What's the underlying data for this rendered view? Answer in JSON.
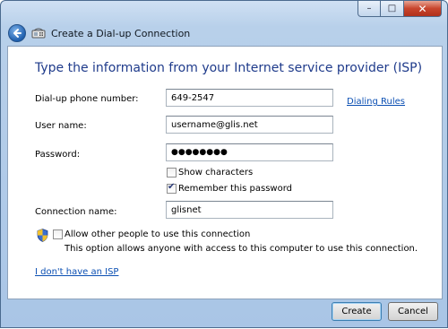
{
  "window": {
    "controls": {
      "minimize": "–",
      "maximize": "□",
      "close": "✕"
    }
  },
  "nav": {
    "title": "Create a Dial-up Connection",
    "back_icon": "back-arrow-icon",
    "app_icon": "dialup-modem-icon"
  },
  "form": {
    "heading": "Type the information from your Internet service provider (ISP)",
    "phone": {
      "label": "Dial-up phone number:",
      "value": "649-2547"
    },
    "dialing_rules_link": "Dialing Rules",
    "username": {
      "label": "User name:",
      "value": "username@glis.net"
    },
    "password": {
      "label": "Password:",
      "value": "●●●●●●●●"
    },
    "show_characters": {
      "label": "Show characters",
      "checked": false
    },
    "remember_password": {
      "label": "Remember this password",
      "checked": true
    },
    "connection_name": {
      "label": "Connection name:",
      "value": "glisnet"
    },
    "allow_others": {
      "label": "Allow other people to use this connection",
      "checked": false,
      "description": "This option allows anyone with access to this computer to use this connection."
    },
    "no_isp_link": "I don't have an ISP"
  },
  "buttons": {
    "create": "Create",
    "cancel": "Cancel"
  },
  "colors": {
    "heading": "#1f3b8b",
    "link": "#0b4fb3",
    "chrome": "#b8d0ea"
  }
}
